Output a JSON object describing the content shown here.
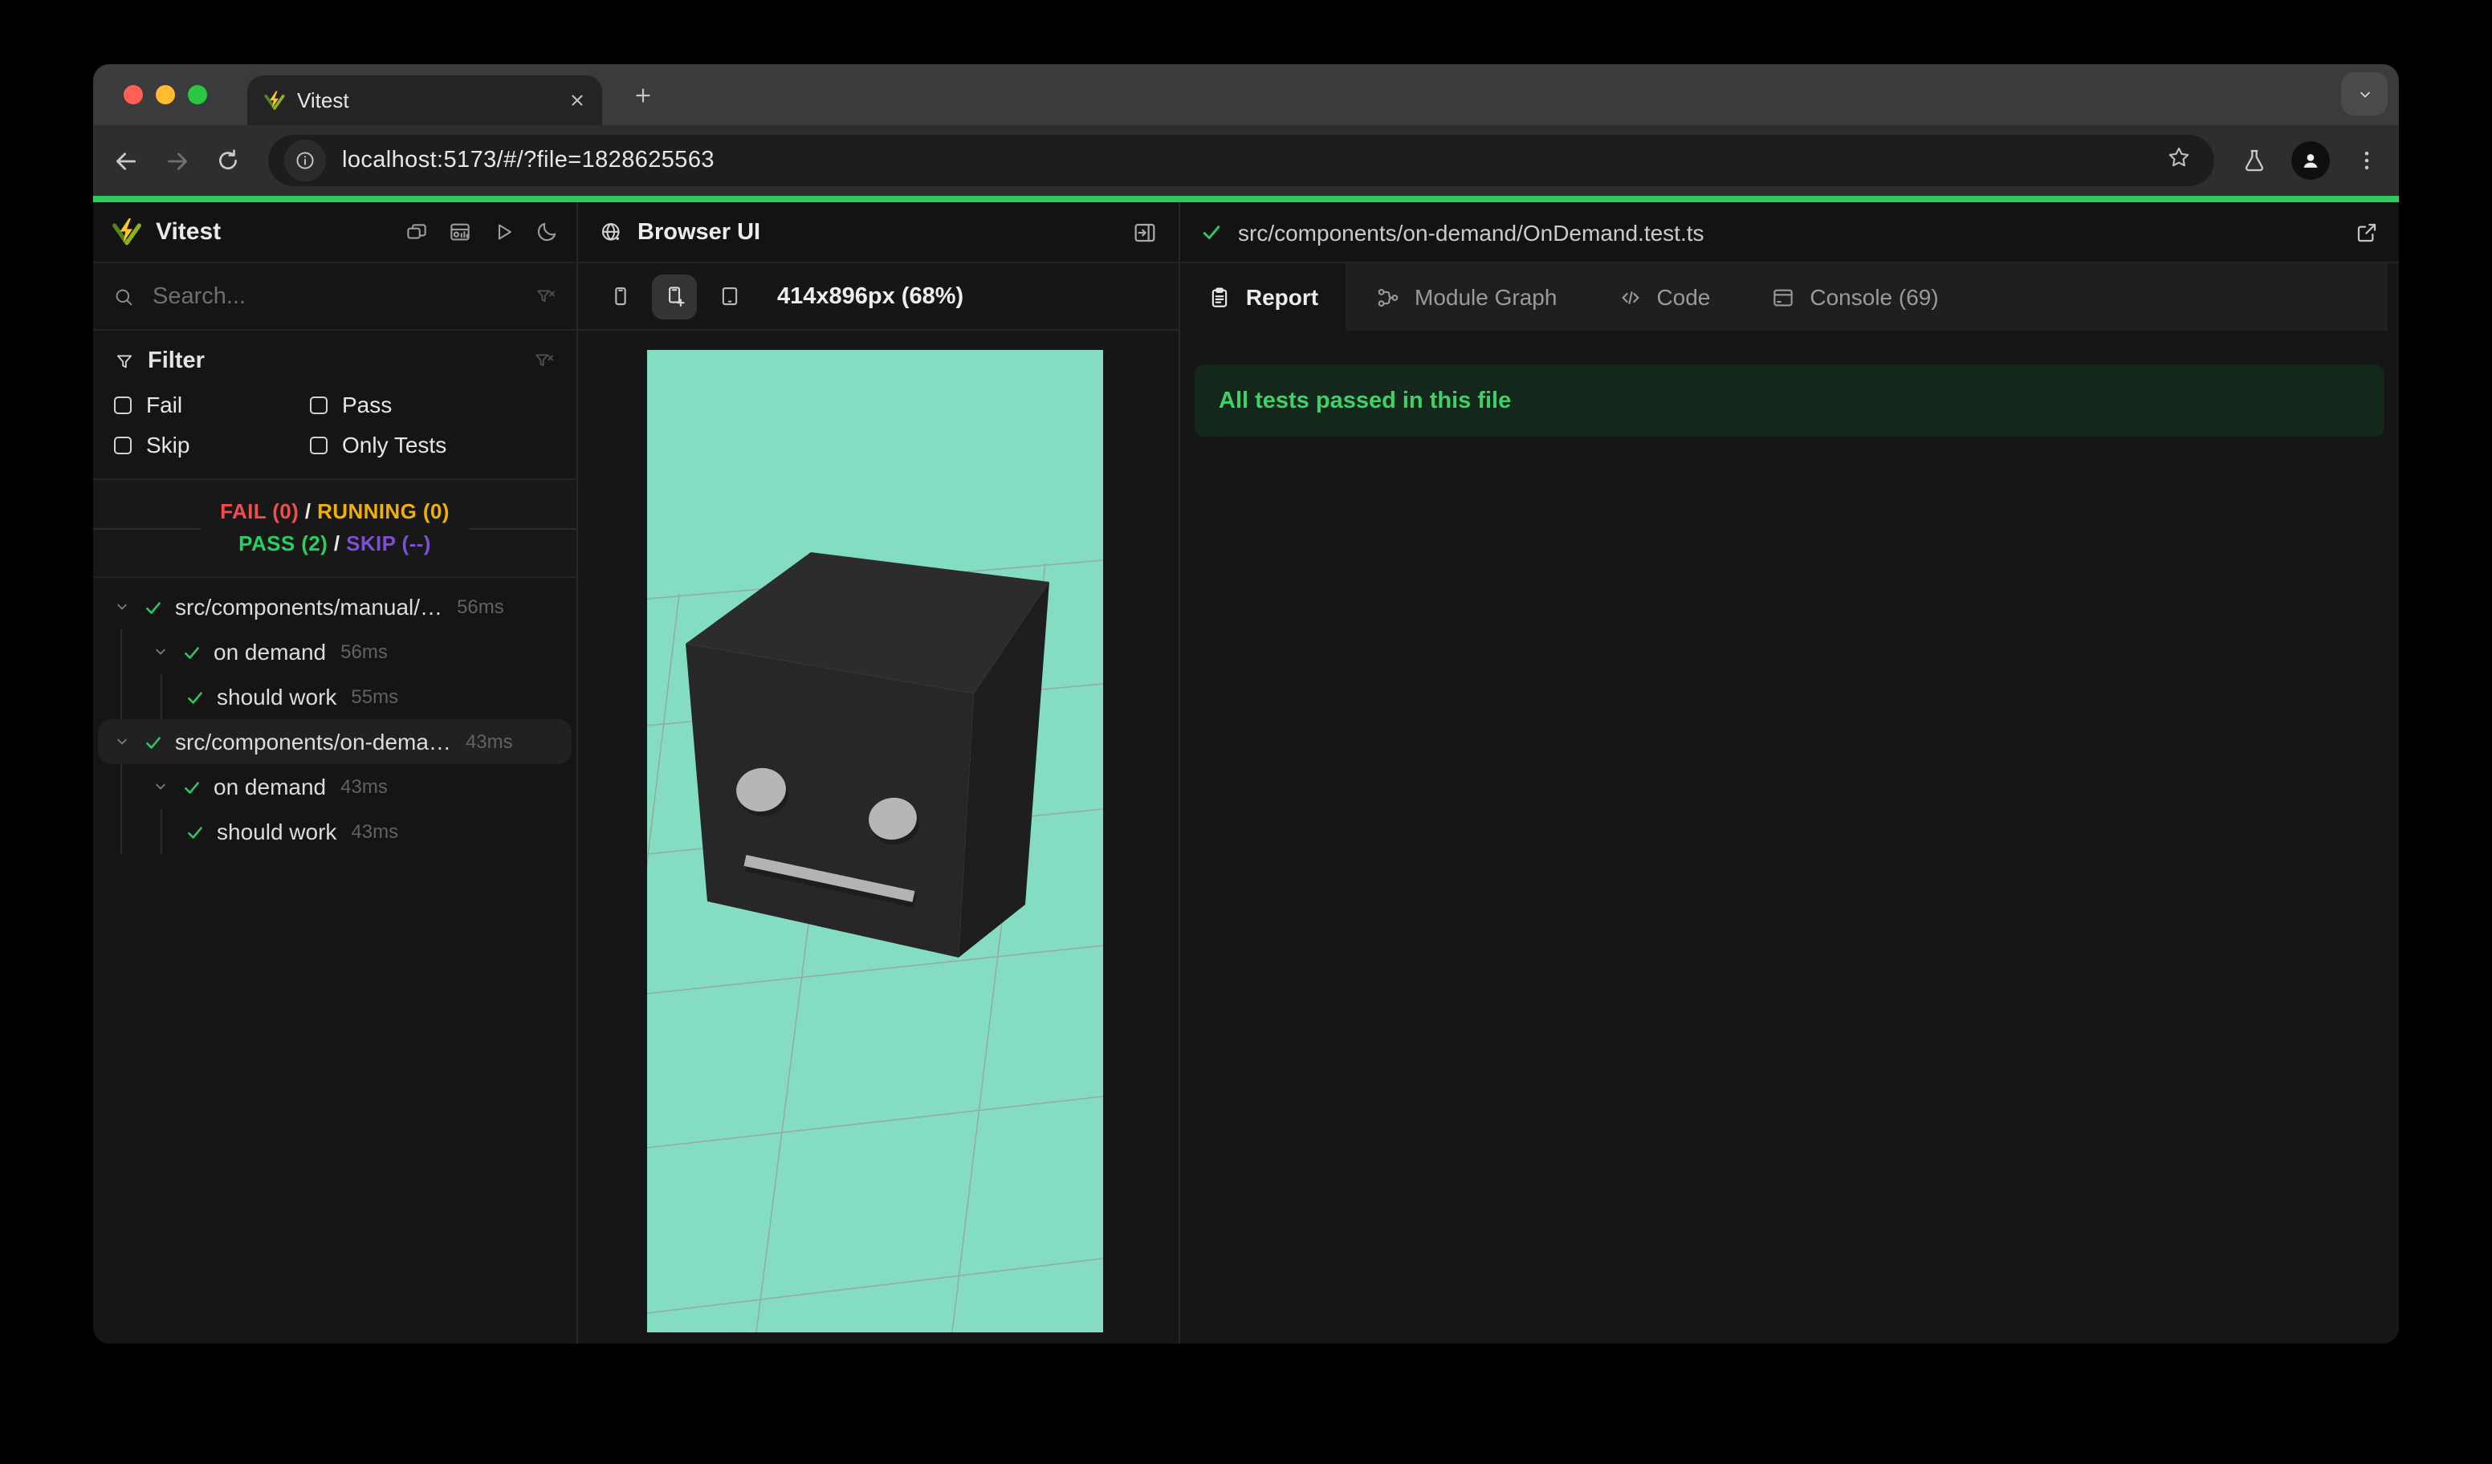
{
  "browser_chrome": {
    "tab_title": "Vitest",
    "url": "localhost:5173/#/?file=1828625563"
  },
  "sidebar": {
    "title": "Vitest",
    "header_buttons": [
      {
        "name": "collapse-windows-button",
        "icon": "windows-icon"
      },
      {
        "name": "dashboard-button",
        "icon": "dashboard-icon"
      },
      {
        "name": "run-all-button",
        "icon": "play-icon"
      },
      {
        "name": "dark-mode-button",
        "icon": "moon-icon"
      }
    ],
    "search": {
      "placeholder": "Search..."
    },
    "filter": {
      "title": "Filter",
      "options": [
        {
          "label": "Fail"
        },
        {
          "label": "Pass"
        },
        {
          "label": "Skip"
        },
        {
          "label": "Only Tests"
        }
      ]
    },
    "summary": {
      "fail": "FAIL (0)",
      "running": "RUNNING (0)",
      "pass": "PASS (2)",
      "skip": "SKIP (--)",
      "separator": "/"
    },
    "tree": [
      {
        "label": "src/components/manual/…",
        "time": "56ms",
        "level": 0,
        "chevron": true,
        "selected": false
      },
      {
        "label": "on demand",
        "time": "56ms",
        "level": 1,
        "chevron": true,
        "selected": false
      },
      {
        "label": "should work",
        "time": "55ms",
        "level": 2,
        "chevron": false,
        "selected": false
      },
      {
        "label": "src/components/on-dema…",
        "time": "43ms",
        "level": 0,
        "chevron": true,
        "selected": true
      },
      {
        "label": "on demand",
        "time": "43ms",
        "level": 1,
        "chevron": true,
        "selected": false
      },
      {
        "label": "should work",
        "time": "43ms",
        "level": 2,
        "chevron": false,
        "selected": false
      }
    ]
  },
  "browser_panel": {
    "title": "Browser UI",
    "viewport_label": "414x896px (68%)",
    "device_buttons": [
      {
        "name": "device-mobile-button",
        "icon": "phone-icon",
        "active": false
      },
      {
        "name": "device-mobile-add-button",
        "icon": "phone-add-icon",
        "active": true
      },
      {
        "name": "device-tablet-button",
        "icon": "tablet-icon",
        "active": false
      }
    ]
  },
  "report_panel": {
    "file_path": "src/components/on-demand/OnDemand.test.ts",
    "tabs": [
      {
        "label": "Report",
        "icon": "clipboard-icon",
        "active": true
      },
      {
        "label": "Module Graph",
        "icon": "module-graph-icon",
        "active": false
      },
      {
        "label": "Code",
        "icon": "code-icon",
        "active": false
      },
      {
        "label": "Console (69)",
        "icon": "console-icon",
        "active": false
      }
    ],
    "banner": "All tests passed in this file"
  },
  "colors": {
    "accent_green": "#2fcb5e",
    "check_green": "#2dc563",
    "mint_background": "#84dcc2",
    "cube_top": "#2c2c2c",
    "cube_front": "#272727",
    "cube_side": "#1e1e1e",
    "fail_red": "#f24d4d",
    "running_yellow": "#f0b100",
    "pass_green": "#23d160",
    "skip_purple": "#7e4fd1",
    "banner_bg": "#13281b",
    "banner_text": "#3ed167"
  }
}
